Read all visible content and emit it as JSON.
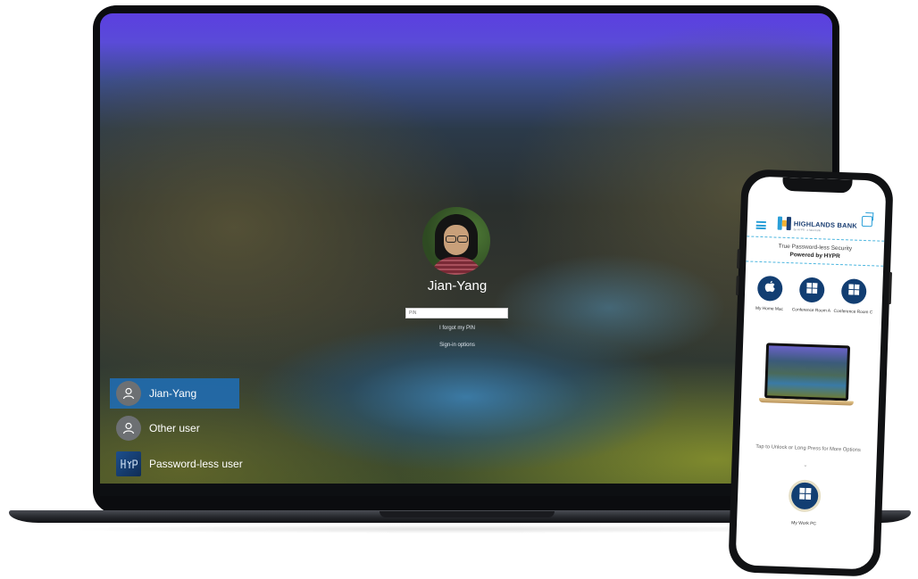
{
  "login": {
    "username": "Jian-Yang",
    "pin_placeholder": "PIN",
    "forgot_pin": "I forgot my PIN",
    "sign_in_options": "Sign-in options"
  },
  "user_list": [
    {
      "label": "Jian-Yang",
      "icon": "person-icon",
      "selected": true
    },
    {
      "label": "Other user",
      "icon": "person-icon",
      "selected": false
    },
    {
      "label": "Password-less user",
      "icon": "hypr-logo-icon",
      "selected": false
    }
  ],
  "phone_app": {
    "bank_name": "HIGHLANDS BANK",
    "bank_subtitle": "by HYPR · a fake bank",
    "tagline_line1": "True Password-less Security",
    "tagline_line2": "Powered by HYPR",
    "devices": [
      {
        "label": "My Home Mac",
        "icon": "apple-icon"
      },
      {
        "label": "Conference Room A",
        "icon": "windows-icon"
      },
      {
        "label": "Conference Room C",
        "icon": "windows-icon"
      }
    ],
    "tap_hint": "Tap to Unlock or Long Press for More Options",
    "chevron": "⌄",
    "primary_device": {
      "label": "My Work PC",
      "icon": "windows-icon"
    }
  },
  "colors": {
    "accent_blue": "#1e6eb9",
    "app_navy": "#123e72",
    "app_cyan": "#2a9fd8"
  }
}
